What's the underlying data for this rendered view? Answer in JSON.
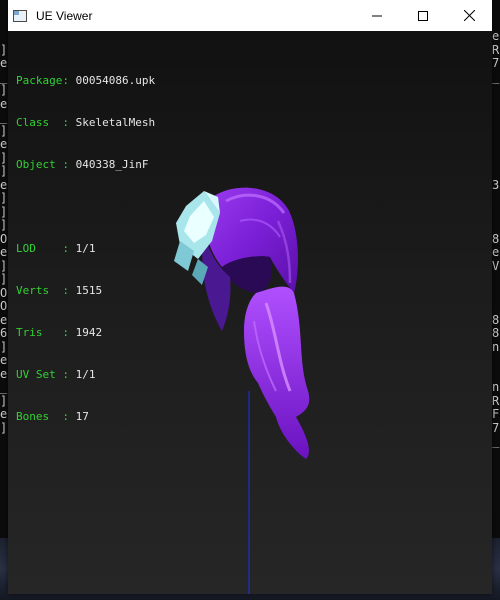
{
  "window": {
    "title": "UE Viewer",
    "controls": [
      "minimize-icon",
      "maximize-icon",
      "close-icon"
    ]
  },
  "info": {
    "package": {
      "label": "Package",
      "value": "00054086.upk"
    },
    "class": {
      "label": "Class  ",
      "value": "SkeletalMesh"
    },
    "object": {
      "label": "Object ",
      "value": "040338_JinF"
    },
    "lod": {
      "label": "LOD    ",
      "value": "1/1"
    },
    "verts": {
      "label": "Verts  ",
      "value": "1515"
    },
    "tris": {
      "label": "Tris   ",
      "value": "1942"
    },
    "uvset": {
      "label": "UV Set ",
      "value": "1/1"
    },
    "bones": {
      "label": "Bones  ",
      "value": "17"
    }
  },
  "background_console": {
    "left": [
      "",
      "]",
      "e",
      "_",
      "]",
      "e",
      "_",
      "]",
      "e",
      "]",
      "]",
      "e",
      "]",
      "]",
      "]",
      "O",
      "e",
      "]",
      "]",
      "O",
      "O",
      "e",
      "6",
      "]",
      "e",
      "e",
      "_",
      "]",
      "e",
      "]"
    ],
    "right": [
      "e",
      "R",
      "7",
      "_",
      "",
      "",
      "",
      "",
      "",
      "",
      "",
      "3",
      "",
      "",
      "",
      "8",
      "e",
      "V",
      "",
      "",
      "",
      "8",
      "8",
      "n",
      "",
      "",
      "n",
      "R",
      "F",
      "7",
      "_",
      "",
      ""
    ]
  },
  "colors": {
    "info_key": "#33d133",
    "info_value": "#e6e6e6",
    "hair_main": "#8a2be2",
    "hair_light": "#c86bff",
    "bone_line": "#1f2fc8",
    "accessory": "#b8f2f2"
  }
}
